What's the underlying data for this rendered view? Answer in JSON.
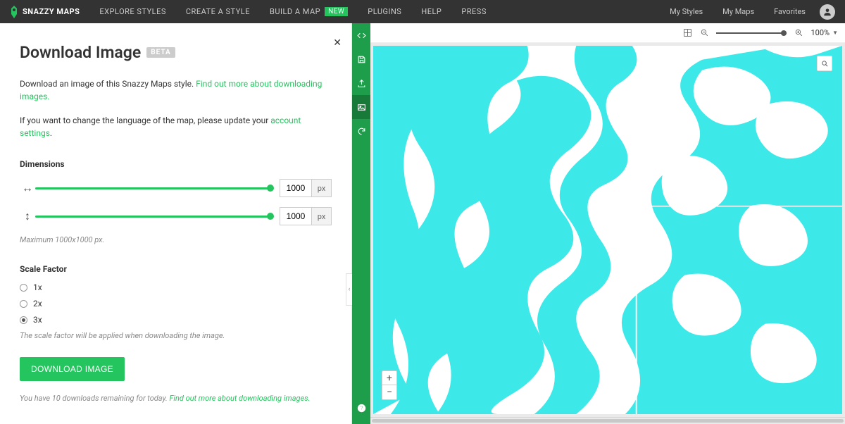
{
  "brand": "SNAZZY MAPS",
  "nav": {
    "explore": "EXPLORE STYLES",
    "create": "CREATE A STYLE",
    "build": "BUILD A MAP",
    "build_badge": "NEW",
    "plugins": "PLUGINS",
    "help": "HELP",
    "press": "PRESS",
    "my_styles": "My Styles",
    "my_maps": "My Maps",
    "favorites": "Favorites"
  },
  "panel": {
    "title": "Download Image",
    "beta": "BETA",
    "desc1_a": "Download an image of this Snazzy Maps style. ",
    "desc1_link": "Find out more about downloading images.",
    "desc2_a": "If you want to change the language of the map, please update your ",
    "desc2_link": "account settings",
    "desc2_b": ".",
    "dimensions_label": "Dimensions",
    "width_value": "1000",
    "height_value": "1000",
    "unit": "px",
    "dimensions_note": "Maximum 1000x1000 px.",
    "scale_label": "Scale Factor",
    "scale_opts": {
      "x1": "1x",
      "x2": "2x",
      "x3": "3x"
    },
    "scale_note": "The scale factor will be applied when downloading the image.",
    "download_btn": "DOWNLOAD IMAGE",
    "remaining_a": "You have 10 downloads remaining for today. ",
    "remaining_link": "Find out more about downloading images."
  },
  "toolbar": {
    "zoom_pct": "100%"
  },
  "sidebar_tools": {
    "code": "code-icon",
    "save": "save-icon",
    "export": "export-icon",
    "image": "image-icon",
    "refresh": "refresh-icon",
    "help": "help-icon"
  },
  "map_controls": {
    "plus": "+",
    "minus": "−"
  },
  "colors": {
    "accent": "#24c45e",
    "water": "#3de8e8"
  }
}
